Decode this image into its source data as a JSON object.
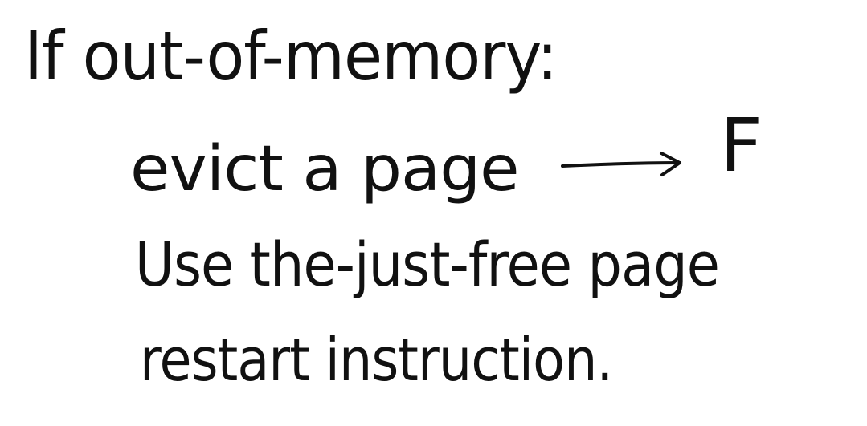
{
  "notes": {
    "top_fragment": "",
    "line_1": "If out-of-memory:",
    "line_2": "evict a page",
    "line_3": "Use the-just-free page",
    "line_4": "restart instruction.",
    "target_label": "F"
  },
  "colors": {
    "ink": "#111111",
    "background": "#ffffff"
  },
  "icons": {
    "arrow": "right-arrow-icon"
  }
}
